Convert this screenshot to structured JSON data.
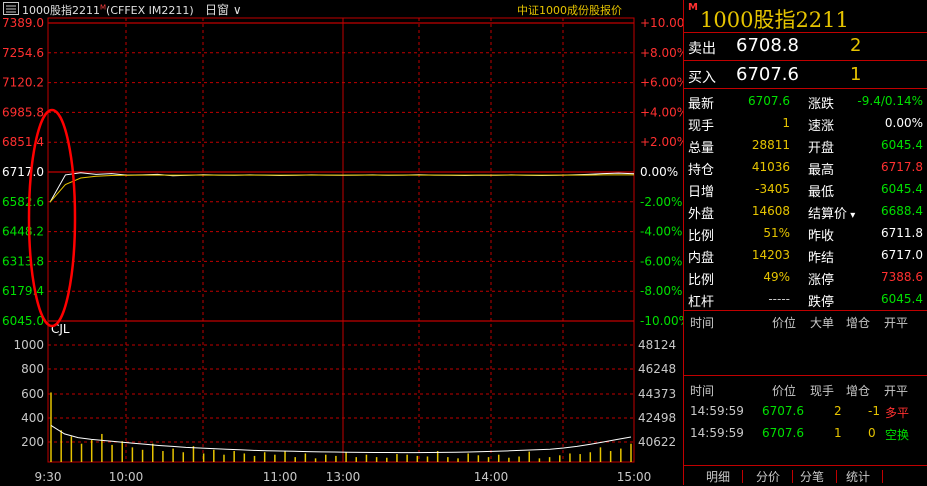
{
  "header": {
    "title": "1000股指2211",
    "title_flag": "M",
    "exchange": "(CFFEX IM2211)",
    "period": "日窗",
    "reference": "中证1000成份股报价"
  },
  "colors": {
    "up": "#ff3030",
    "down": "#00e000",
    "flat": "#ffffff",
    "accent": "#e6c400",
    "grid": "#c00000"
  },
  "chart_data": [
    {
      "type": "line",
      "title": "",
      "y_price_ticks": [
        "7389.0",
        "7254.6",
        "7120.2",
        "6985.8",
        "6851.4",
        "6717.0",
        "6582.6",
        "6448.2",
        "6313.8",
        "6179.4",
        "6045.0"
      ],
      "y_percent_ticks": [
        "+10.00%",
        "+8.00%",
        "+6.00%",
        "+4.00%",
        "+2.00%",
        "0.00%",
        "-2.00%",
        "-4.00%",
        "-6.00%",
        "-8.00%",
        "-10.00%"
      ],
      "ylim": [
        6045.0,
        7389.0
      ],
      "prev_settle": 6717.0,
      "x_ticks": [
        "9:30",
        "10:00",
        "11:00/13:00",
        "14:00",
        "15:00"
      ],
      "series": [
        {
          "values": [
            6581.0,
            6704.0,
            6714.0,
            6706.0,
            6710.0,
            6703.0,
            6704.0,
            6706.0,
            6700.0,
            6702.0,
            6705.0,
            6703.0,
            6702.0,
            6704.0,
            6703.0,
            6701.0,
            6702.0,
            6704.0,
            6703.0,
            6702.0,
            6703.0,
            6704.0,
            6702.0,
            6703.0,
            6705.0,
            6703.0,
            6702.0,
            6701.0,
            6703.0,
            6702.0,
            6704.0,
            6702.0,
            6701.0,
            6702.0,
            6704.0,
            6706.0,
            6710.0,
            6712.0,
            6708.8
          ]
        },
        {
          "values": [
            6581.0,
            6660.0,
            6690.0,
            6698.0,
            6701.0,
            6702.0,
            6703.0,
            6703.0,
            6703.0,
            6703.0,
            6703.0,
            6703.0,
            6703.0,
            6703.0,
            6703.0,
            6703.0,
            6703.0,
            6703.0,
            6703.0,
            6703.0,
            6703.0,
            6703.0,
            6703.0,
            6703.0,
            6703.0,
            6703.0,
            6703.0,
            6703.0,
            6703.0,
            6703.0,
            6703.0,
            6703.0,
            6703.0,
            6703.0,
            6703.0,
            6703.0,
            6704.0,
            6704.0,
            6704.0
          ]
        }
      ]
    },
    {
      "type": "bar",
      "title": "",
      "indicator_label": "CJL",
      "y_volume_ticks": [
        "1000",
        "800",
        "600",
        "400",
        "200"
      ],
      "y_oi_ticks": [
        "48124",
        "46248",
        "44373",
        "42498",
        "40622"
      ],
      "ylim": [
        0,
        1000
      ],
      "values": [
        570,
        260,
        210,
        150,
        180,
        230,
        140,
        170,
        120,
        100,
        150,
        90,
        110,
        80,
        130,
        70,
        100,
        60,
        90,
        70,
        50,
        80,
        60,
        90,
        40,
        70,
        30,
        60,
        50,
        80,
        40,
        60,
        40,
        35,
        65,
        60,
        50,
        45,
        90,
        40,
        30,
        70,
        55,
        40,
        60,
        35,
        45,
        85,
        30,
        40,
        55,
        70,
        65,
        80,
        120,
        90,
        110,
        150
      ],
      "oi_line": [
        300,
        230,
        200,
        185,
        175,
        165,
        155,
        145,
        135,
        128,
        120,
        115,
        110,
        105,
        100,
        95,
        92,
        90,
        88,
        85,
        83,
        82,
        80,
        79,
        78,
        78,
        77,
        77,
        78,
        79,
        80,
        82,
        85,
        88,
        92,
        96,
        100,
        105,
        115,
        128,
        145,
        165,
        185,
        205
      ]
    }
  ],
  "quote": {
    "sell_label": "卖出",
    "sell_price": "6708.8",
    "sell_vol": "2",
    "buy_label": "买入",
    "buy_price": "6707.6",
    "buy_vol": "1"
  },
  "stats_left": [
    {
      "label": "最新",
      "value": "6707.6",
      "color": "#00e000"
    },
    {
      "label": "现手",
      "value": "1",
      "color": "#e6c400"
    },
    {
      "label": "总量",
      "value": "28811",
      "color": "#e6c400"
    },
    {
      "label": "持仓",
      "value": "41036",
      "color": "#e6c400"
    },
    {
      "label": "日增",
      "value": "-3405",
      "color": "#e6c400"
    },
    {
      "label": "外盘",
      "value": "14608",
      "color": "#e6c400"
    },
    {
      "label": "比例",
      "value": "51%",
      "color": "#e6c400"
    },
    {
      "label": "内盘",
      "value": "14203",
      "color": "#e6c400"
    },
    {
      "label": "比例",
      "value": "49%",
      "color": "#e6c400"
    },
    {
      "label": "杠杆",
      "value": "-----",
      "color": "#c8c8c8"
    }
  ],
  "stats_right": [
    {
      "label": "涨跌",
      "value": "-9.4/0.14%",
      "color": "#00e000"
    },
    {
      "label": "速涨",
      "value": "0.00%",
      "color": "#ffffff"
    },
    {
      "label": "开盘",
      "value": "6045.4",
      "color": "#00e000"
    },
    {
      "label": "最高",
      "value": "6717.8",
      "color": "#ff3030"
    },
    {
      "label": "最低",
      "value": "6045.4",
      "color": "#00e000"
    },
    {
      "label": "结算价",
      "value": "6688.4",
      "color": "#00e000",
      "dropdown": true
    },
    {
      "label": "昨收",
      "value": "6711.8",
      "color": "#ffffff"
    },
    {
      "label": "昨结",
      "value": "6717.0",
      "color": "#ffffff"
    },
    {
      "label": "涨停",
      "value": "7388.6",
      "color": "#ff3030"
    },
    {
      "label": "跌停",
      "value": "6045.4",
      "color": "#00e000"
    }
  ],
  "bigorders": {
    "headers": [
      "时间",
      "价位",
      "大单",
      "增仓",
      "开平"
    ]
  },
  "ticks": {
    "headers": [
      "时间",
      "价位",
      "现手",
      "增仓",
      "开平"
    ],
    "rows": [
      {
        "time": "14:59:59",
        "price": "6707.6",
        "vol": "2",
        "oi": "-1",
        "type": "多平",
        "type_color": "#ff3030"
      },
      {
        "time": "14:59:59",
        "price": "6707.6",
        "vol": "1",
        "oi": "0",
        "type": "空换",
        "type_color": "#00e000"
      }
    ]
  },
  "tabs": [
    "明细",
    "分价",
    "分笔",
    "统计"
  ]
}
